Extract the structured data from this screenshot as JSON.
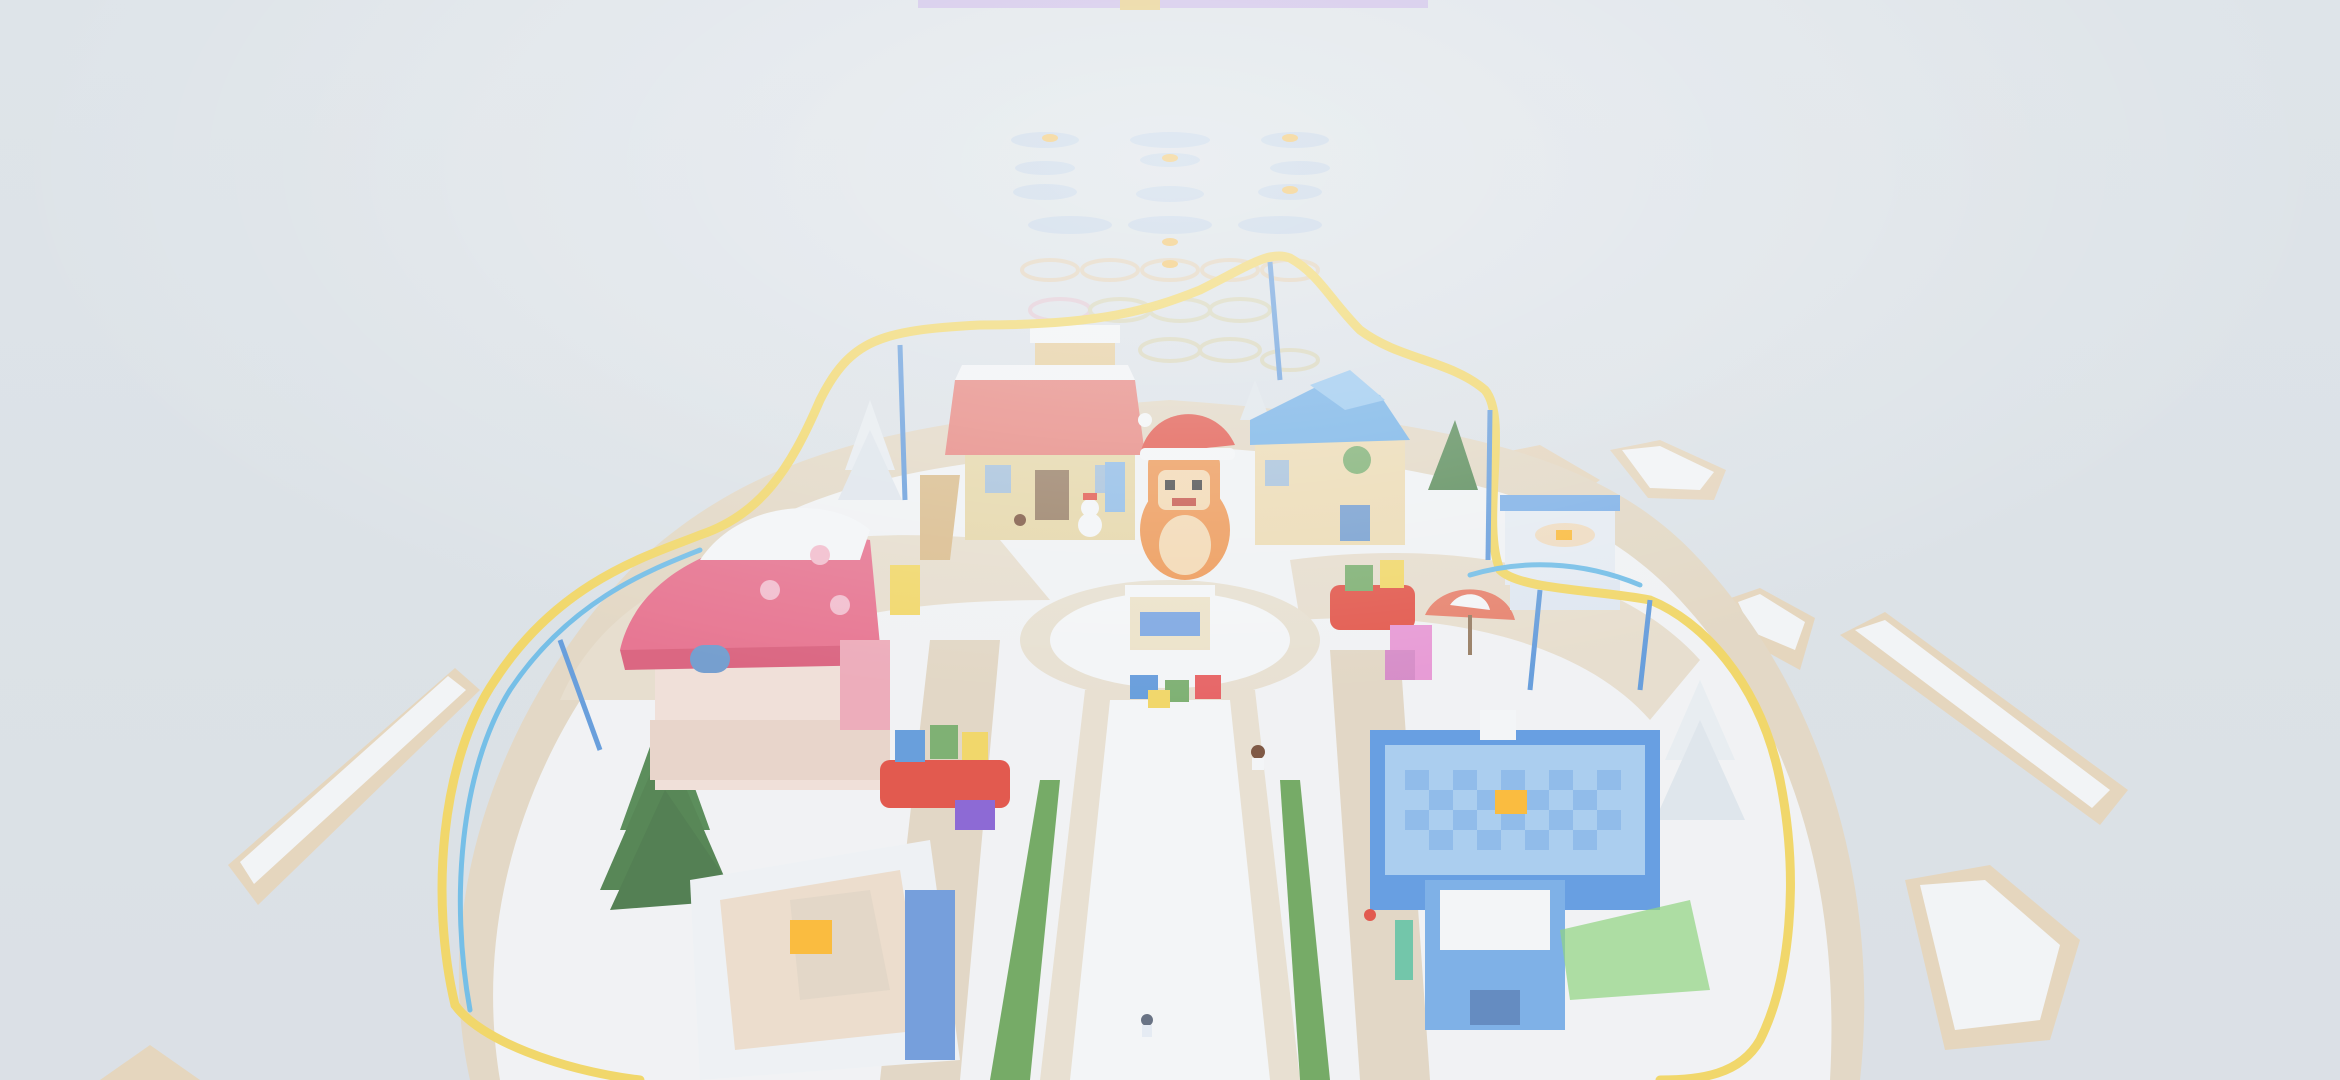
{
  "scene": {
    "description_key": "winter-holiday-island-overview",
    "colors": {
      "sky": "#dfe5ea",
      "snow": "#f7f8f9",
      "ground_beige": "#e6dccb",
      "path": "#ece6da",
      "coaster_rail": "#f5d44f",
      "coaster_support": "#4f8fd8",
      "pink_house": "#e85f7f",
      "blue_house": "#4d8fe0",
      "tree": "#3f7a3c",
      "mascot_orange": "#f08a3a",
      "santa_red": "#e23b2c",
      "pad_orange": "#ffb21a"
    }
  }
}
